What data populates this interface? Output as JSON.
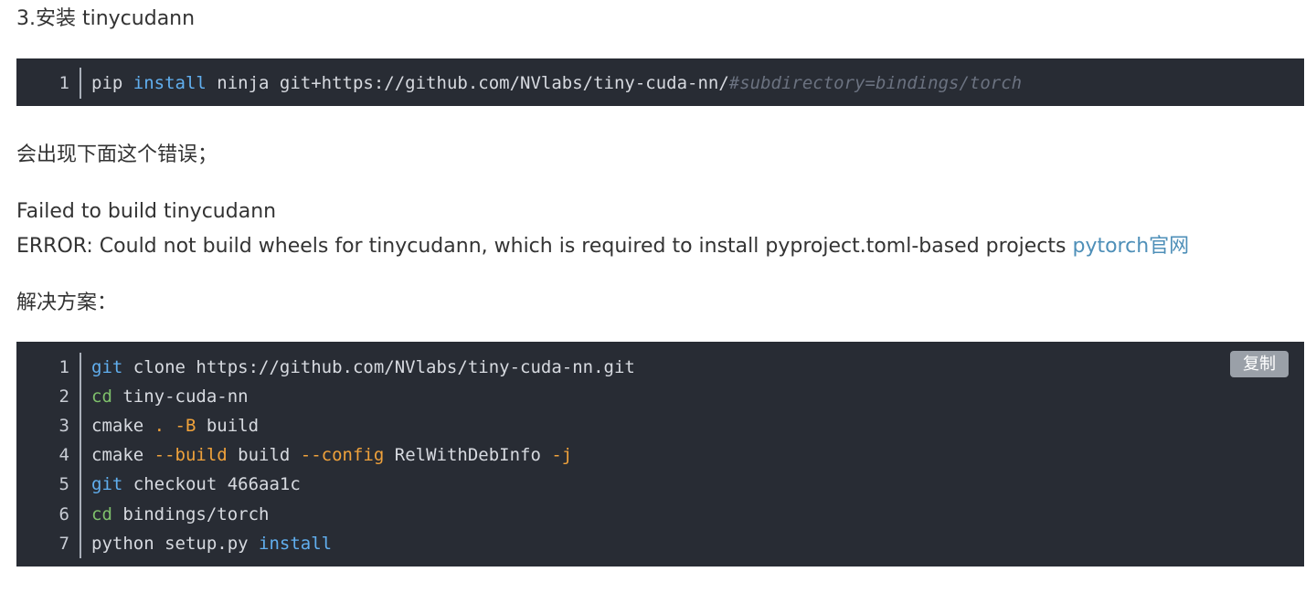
{
  "heading": "3.安装 tinycudann",
  "block1": {
    "line_number": "1",
    "tokens": [
      "pip ",
      "install",
      " ninja git+https://github.com/NVlabs/tiny-cuda-nn/",
      "#subdirectory=bindings/torch"
    ]
  },
  "para_error_intro": "会出现下面这个错误；",
  "error_line1": "Failed to build tinycudann",
  "error_line2": "ERROR: Could not build wheels for tinycudann, which is required to install pyproject.toml-based projects ",
  "error_link": "pytorch官网",
  "para_solution": "解决方案：",
  "block2": {
    "copy_label": "复制",
    "lines": [
      {
        "n": "1",
        "t": [
          "git",
          " clone https://github.com/NVlabs/tiny-cuda-nn.git"
        ]
      },
      {
        "n": "2",
        "t": [
          "cd",
          " tiny-cuda-nn"
        ]
      },
      {
        "n": "3",
        "t": [
          "cmake ",
          ". -B",
          " build"
        ]
      },
      {
        "n": "4",
        "t": [
          "cmake ",
          "--build",
          " build ",
          "--config",
          " RelWithDebInfo ",
          "-j"
        ]
      },
      {
        "n": "5",
        "t": [
          "git",
          " checkout 466aa1c"
        ]
      },
      {
        "n": "6",
        "t": [
          "cd",
          " bindings/torch"
        ]
      },
      {
        "n": "7",
        "t": [
          "python setup.py ",
          "install"
        ]
      }
    ]
  }
}
